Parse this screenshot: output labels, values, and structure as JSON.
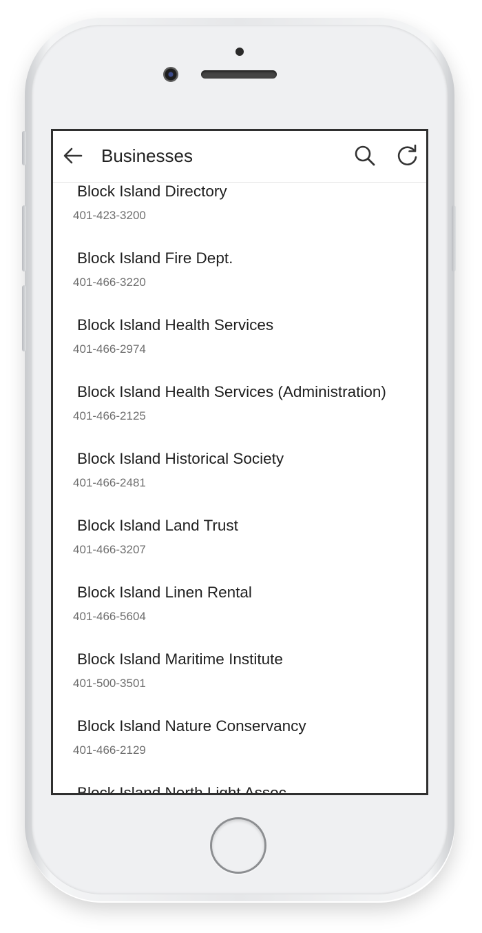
{
  "appbar": {
    "title": "Businesses",
    "back_icon": "arrow-back-icon",
    "search_icon": "search-icon",
    "refresh_icon": "refresh-icon"
  },
  "businesses": [
    {
      "name": "Block Island Directory",
      "phone": "401-423-3200"
    },
    {
      "name": "Block Island Fire Dept.",
      "phone": "401-466-3220"
    },
    {
      "name": "Block Island Health Services",
      "phone": "401-466-2974"
    },
    {
      "name": "Block Island Health Services (Administration)",
      "phone": "401-466-2125"
    },
    {
      "name": "Block Island Historical Society",
      "phone": "401-466-2481"
    },
    {
      "name": "Block Island Land Trust",
      "phone": "401-466-3207"
    },
    {
      "name": "Block Island Linen Rental",
      "phone": "401-466-5604"
    },
    {
      "name": "Block Island Maritime Institute",
      "phone": "401-500-3501"
    },
    {
      "name": "Block Island Nature Conservancy",
      "phone": "401-466-2129"
    },
    {
      "name": "Block Island North Light Assoc",
      "phone": ""
    }
  ],
  "colors": {
    "title": "#212121",
    "item_name": "#1e1e1e",
    "item_phone": "#6e6e6e",
    "icon": "#333333",
    "screen_border": "#2f2f2f"
  }
}
